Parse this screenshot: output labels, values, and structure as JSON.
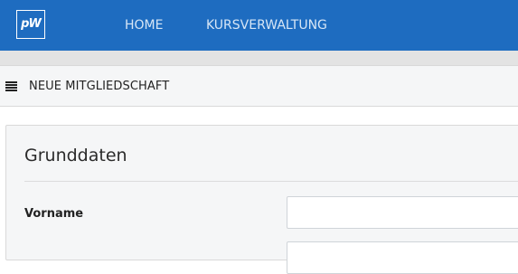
{
  "header": {
    "logo_text": "pW",
    "nav": [
      {
        "label": "HOME"
      },
      {
        "label": "KURSVERWALTUNG"
      }
    ],
    "background_color": "#1e6cc0"
  },
  "subheader": {
    "menu_icon": "hamburger-menu-icon",
    "title": "NEUE MITGLIEDSCHAFT"
  },
  "form": {
    "section_title": "Grunddaten",
    "fields": [
      {
        "label": "Vorname",
        "value": "",
        "placeholder": ""
      }
    ]
  }
}
